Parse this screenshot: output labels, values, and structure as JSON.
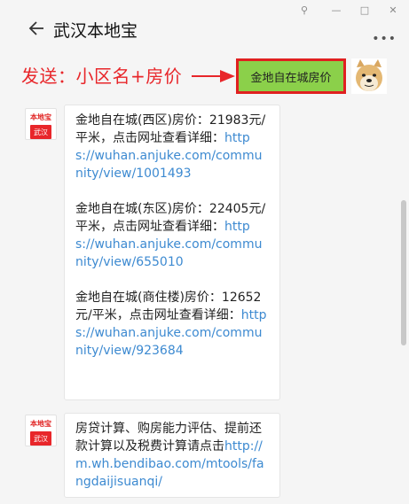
{
  "window": {
    "pin_glyph": "⚲",
    "minimize_glyph": "—",
    "maximize_glyph": "□",
    "close_glyph": "✕"
  },
  "header": {
    "title": "武汉本地宝",
    "more_glyph": "•••"
  },
  "banner": {
    "instruction": "发送：小区名+房价",
    "send_keyword": "金地自在城房价"
  },
  "avatar": {
    "top_text": "本地宝",
    "bottom_text": "武汉"
  },
  "messages": [
    {
      "paragraphs": [
        {
          "text": "金地自在城(西区)房价：21983元/平米，点击网址查看详细：",
          "link": "https://wuhan.anjuke.com/community/view/1001493"
        },
        {
          "text": "金地自在城(东区)房价：22405元/平米，点击网址查看详细：",
          "link": "https://wuhan.anjuke.com/community/view/655010"
        },
        {
          "text": "金地自在城(商住楼)房价：12652元/平米，点击网址查看详细：",
          "link": "https://wuhan.anjuke.com/community/view/923684"
        }
      ]
    },
    {
      "paragraphs": [
        {
          "text": "房贷计算、购房能力评估、提前还款计算以及税费计算请点击",
          "link": "http://m.wh.bendibao.com/mtools/fangdaijisuanqi/"
        }
      ]
    }
  ],
  "colors": {
    "accent_red": "#e8262a",
    "send_green": "#8bd04a",
    "link_blue": "#3d8ad1"
  }
}
